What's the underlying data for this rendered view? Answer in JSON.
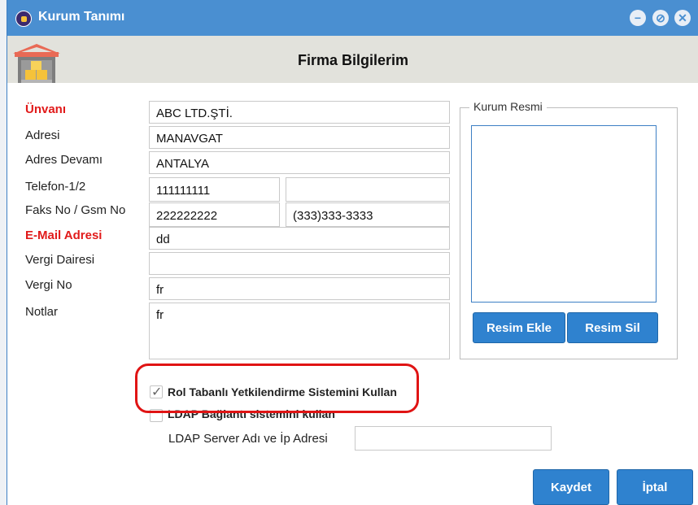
{
  "window": {
    "title": "Kurum Tanımı"
  },
  "header": {
    "title": "Firma Bilgilerim"
  },
  "form": {
    "unvan_label": "Ünvanı",
    "unvan_value": "ABC LTD.ŞTİ.",
    "adres_label": "Adresi",
    "adres_value": "MANAVGAT",
    "adres_devami_label": "Adres Devamı",
    "adres_devami_value": "ANTALYA",
    "telefon_label": "Telefon-1/2",
    "telefon1_value": "111111111",
    "telefon2_value": "",
    "faks_label": "Faks No / Gsm No",
    "faks_value": "222222222",
    "gsm_value": "(333)333-3333",
    "email_label": "E-Mail Adresi",
    "email_value": "dd",
    "vergi_dairesi_label": "Vergi Dairesi",
    "vergi_dairesi_value": "",
    "vergi_no_label": "Vergi No",
    "vergi_no_value": "fr",
    "notlar_label": "Notlar",
    "notlar_value": "fr"
  },
  "image_panel": {
    "legend": "Kurum Resmi",
    "add_label": "Resim Ekle",
    "delete_label": "Resim Sil"
  },
  "options": {
    "rol_label": "Rol Tabanlı Yetkilendirme Sistemini Kullan",
    "rol_checked": true,
    "ldap_label": "LDAP Bağlantı sistemini kullan",
    "ldap_checked": false,
    "ldap_server_label": "LDAP Server Adı ve İp Adresi",
    "ldap_server_value": ""
  },
  "footer": {
    "save_label": "Kaydet",
    "cancel_label": "İptal"
  },
  "colors": {
    "titlebar": "#4a8fd1",
    "button": "#2f82cf",
    "required": "#e11a1a",
    "highlight": "#e01414"
  }
}
